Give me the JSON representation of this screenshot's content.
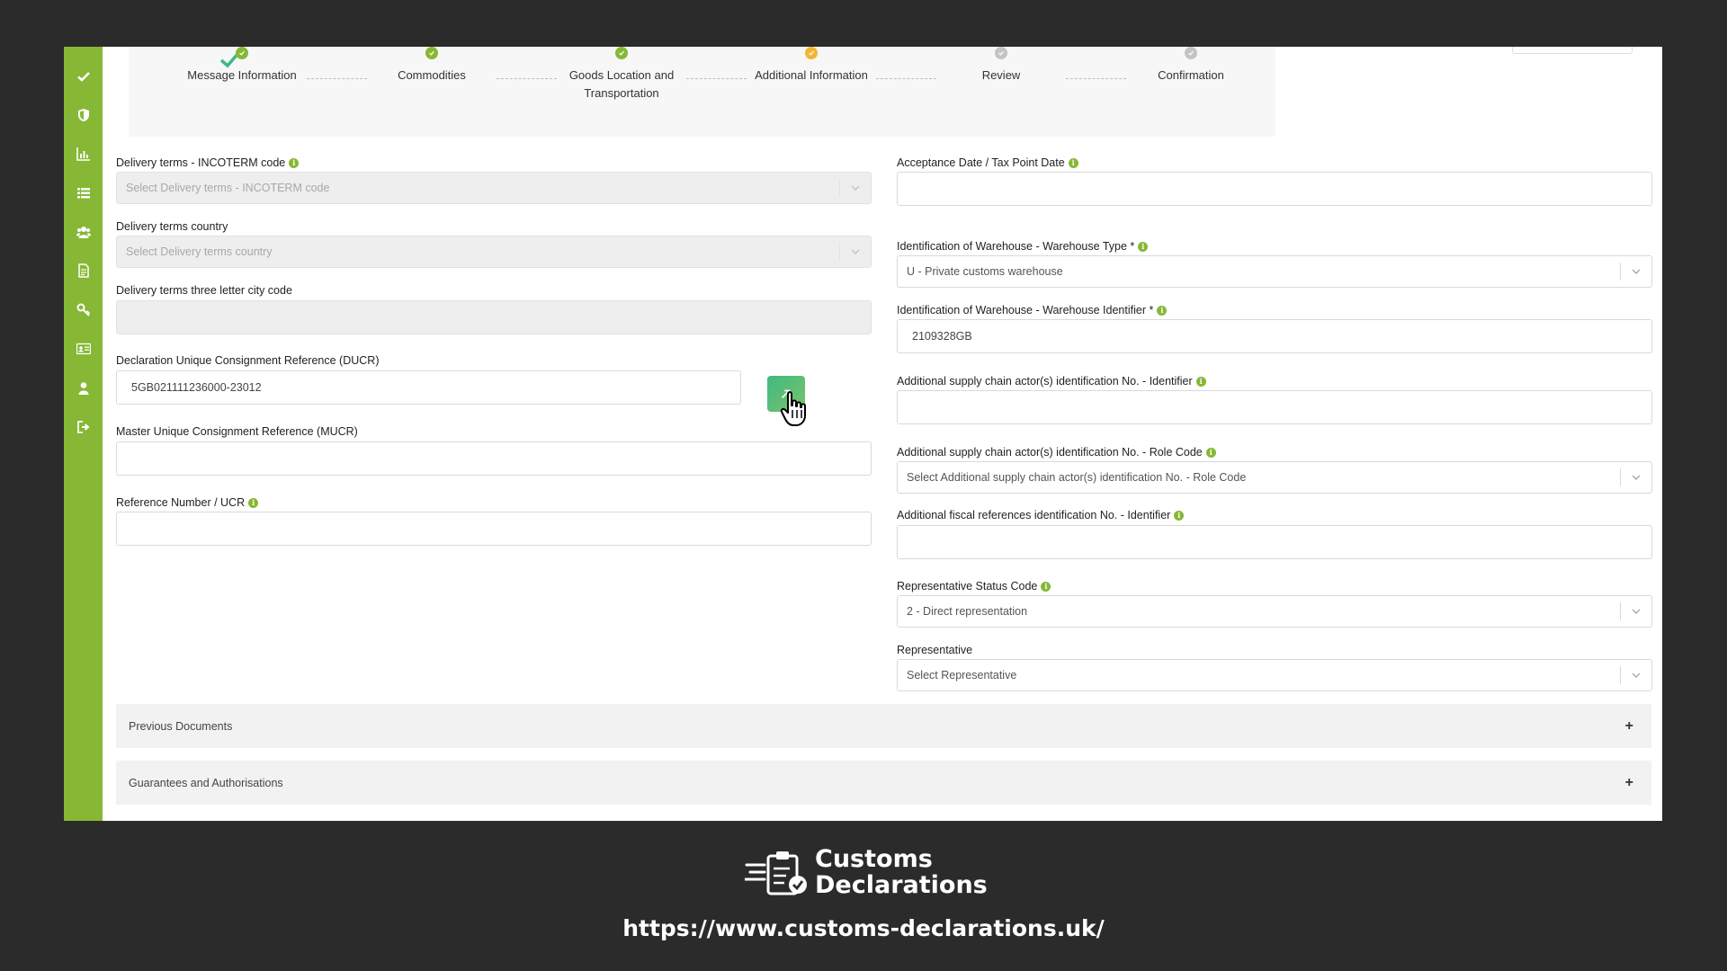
{
  "stepper": {
    "steps": [
      {
        "label": "Message Information",
        "status": "done"
      },
      {
        "label": "Commodities",
        "status": "done"
      },
      {
        "label": "Goods Location and Transportation",
        "status": "done"
      },
      {
        "label": "Additional Information",
        "status": "current"
      },
      {
        "label": "Review",
        "status": "pending"
      },
      {
        "label": "Confirmation",
        "status": "pending"
      }
    ],
    "colors": {
      "done": "#86b835",
      "current": "#f2b632",
      "pending": "#c4c4c4"
    }
  },
  "left": {
    "incoterm": {
      "label": "Delivery terms - INCOTERM code",
      "placeholder": "Select Delivery terms - INCOTERM code"
    },
    "terms_country": {
      "label": "Delivery terms country",
      "placeholder": "Select Delivery terms country"
    },
    "city_code": {
      "label": "Delivery terms three letter city code",
      "value": ""
    },
    "ducr": {
      "label": "Declaration Unique Consignment Reference (DUCR)",
      "value": "5GB021111236000-23012"
    },
    "mucr": {
      "label": "Master Unique Consignment Reference (MUCR)",
      "value": ""
    },
    "ucr": {
      "label": "Reference Number / UCR",
      "value": ""
    }
  },
  "right": {
    "acceptance_date": {
      "label": "Acceptance Date / Tax Point Date",
      "value": ""
    },
    "warehouse_type": {
      "label": "Identification of Warehouse - Warehouse Type *",
      "value": "U - Private customs warehouse"
    },
    "warehouse_id": {
      "label": "Identification of Warehouse - Warehouse Identifier *",
      "value": "2109328GB"
    },
    "supply_chain_id": {
      "label": "Additional supply chain actor(s) identification No. - Identifier",
      "value": ""
    },
    "supply_chain_role": {
      "label": "Additional supply chain actor(s) identification No. - Role Code",
      "placeholder": "Select Additional supply chain actor(s) identification No. - Role Code"
    },
    "fiscal_ref": {
      "label": "Additional fiscal references identification No. - Identifier",
      "value": ""
    },
    "rep_status": {
      "label": "Representative Status Code",
      "value": "2 - Direct representation"
    },
    "representative": {
      "label": "Representative",
      "placeholder": "Select Representative"
    }
  },
  "accordions": [
    {
      "label": "Previous Documents",
      "icon": "+"
    },
    {
      "label": "Guarantees and Authorisations",
      "icon": "+"
    }
  ],
  "sidebar_icons": [
    "check-icon",
    "shield-icon",
    "bar-chart-icon",
    "list-icon",
    "users-icon",
    "document-icon",
    "key-icon",
    "id-card-icon",
    "user-icon",
    "sign-out-icon"
  ],
  "brand": {
    "line1": "Customs",
    "line2": "Declarations",
    "url": "https://www.customs-declarations.uk/"
  },
  "colors": {
    "sidebar": "#86b835",
    "accent_green": "#3fb982",
    "backdrop": "#2b2b2b"
  }
}
